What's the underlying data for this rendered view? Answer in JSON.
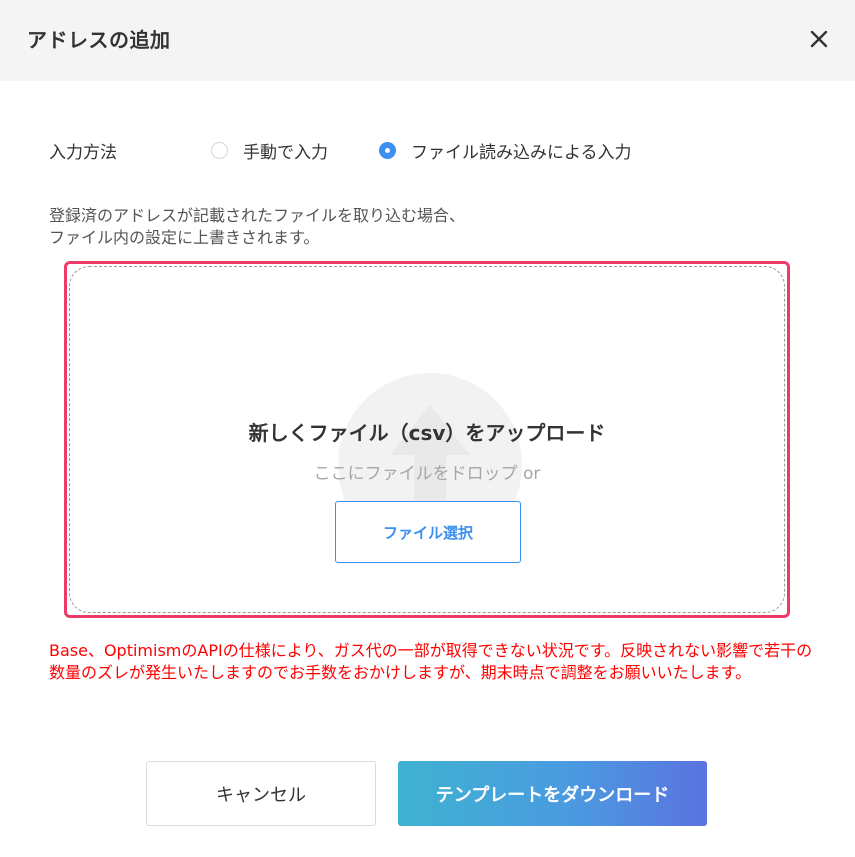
{
  "dialog": {
    "title": "アドレスの追加",
    "close_icon": "close-icon"
  },
  "input_method": {
    "label": "入力方法",
    "options": [
      {
        "label": "手動で入力",
        "selected": false
      },
      {
        "label": "ファイル読み込みによる入力",
        "selected": true
      }
    ]
  },
  "description": {
    "line1": "登録済のアドレスが記載されたファイルを取り込む場合、",
    "line2": "ファイル内の設定に上書きされます。"
  },
  "upload": {
    "title": "新しくファイル（csv）をアップロード",
    "subtitle": "ここにファイルをドロップ or",
    "select_button": "ファイル選択",
    "watermark_icon": "upload-icon"
  },
  "notice": "Base、OptimismのAPIの仕様により、ガス代の一部が取得できない状況です。反映されない影響で若干の数量のズレが発生いたしますのでお手数をおかけしますが、期末時点で調整をお願いいたします。",
  "footer": {
    "cancel_label": "キャンセル",
    "download_label": "テンプレートをダウンロード"
  },
  "colors": {
    "accent": "#3a8ff0",
    "highlight_border": "#ee3a67",
    "notice_text": "#ff0000",
    "gradient_start": "#3fb2d1",
    "gradient_end": "#5b73e0"
  }
}
